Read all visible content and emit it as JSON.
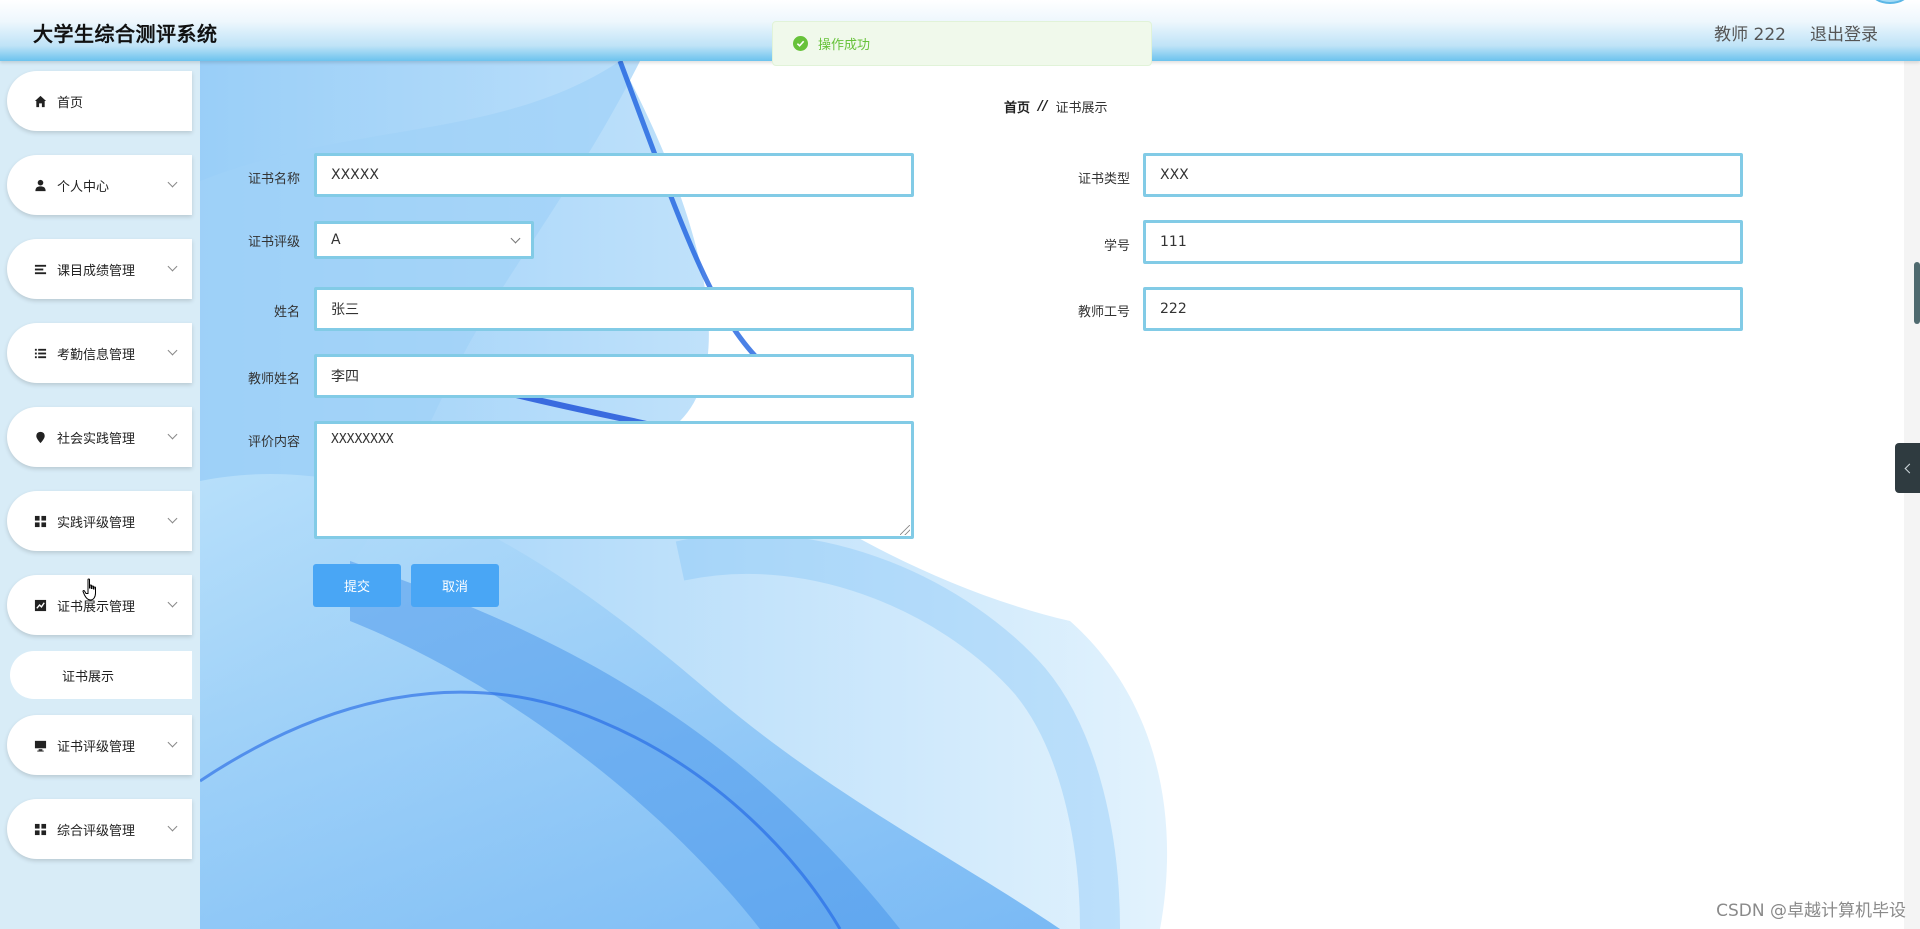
{
  "header": {
    "title": "大学生综合测评系统",
    "user": "教师 222",
    "logout": "退出登录"
  },
  "toast": {
    "text": "操作成功",
    "icon": "check-circle-icon",
    "color": "#67c23a"
  },
  "sidebar": {
    "items": [
      {
        "label": "首页",
        "icon": "home-icon"
      },
      {
        "label": "个人中心",
        "icon": "user-icon"
      },
      {
        "label": "课目成绩管理",
        "icon": "list-icon"
      },
      {
        "label": "考勤信息管理",
        "icon": "list-indent-icon"
      },
      {
        "label": "社会实践管理",
        "icon": "pin-icon"
      },
      {
        "label": "实践评级管理",
        "icon": "grid-icon"
      },
      {
        "label": "证书展示管理",
        "icon": "chart-icon"
      },
      {
        "label": "证书评级管理",
        "icon": "monitor-icon"
      },
      {
        "label": "综合评级管理",
        "icon": "grid-icon"
      }
    ],
    "sub_item": "证书展示"
  },
  "breadcrumb": {
    "home": "首页",
    "sep": "//",
    "current": "证书展示"
  },
  "form": {
    "cert_name": {
      "label": "证书名称",
      "value": "XXXXX"
    },
    "cert_type": {
      "label": "证书类型",
      "value": "XXX"
    },
    "cert_level": {
      "label": "证书评级",
      "value": "A"
    },
    "student_no": {
      "label": "学号",
      "value": "111"
    },
    "name": {
      "label": "姓名",
      "value": "张三"
    },
    "teacher_no": {
      "label": "教师工号",
      "value": "222"
    },
    "teacher_name": {
      "label": "教师姓名",
      "value": "李四"
    },
    "comment": {
      "label": "评价内容",
      "value": "XXXXXXXX"
    },
    "submit": "提交",
    "cancel": "取消"
  },
  "watermark": "CSDN @卓越计算机毕设",
  "colors": {
    "accent": "#49a6f5",
    "field_border": "#82cbe6",
    "sidebar_bg": "#d8ecf7"
  }
}
